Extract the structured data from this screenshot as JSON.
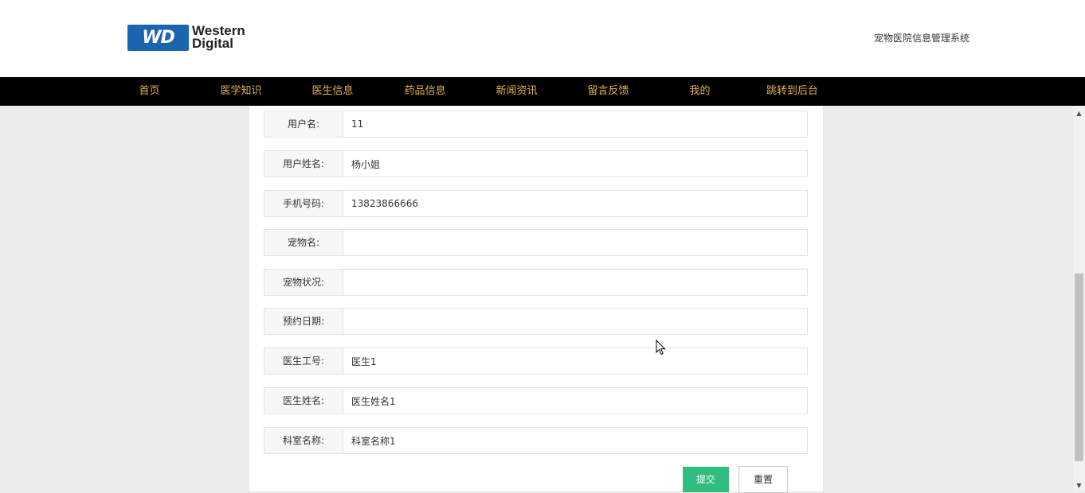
{
  "header": {
    "logo": {
      "badge": "WD",
      "line1": "Western",
      "line2": "Digital"
    },
    "site_title": "宠物医院信息管理系统"
  },
  "nav": {
    "items": [
      {
        "label": "首页"
      },
      {
        "label": "医学知识"
      },
      {
        "label": "医生信息"
      },
      {
        "label": "药品信息"
      },
      {
        "label": "新闻资讯"
      },
      {
        "label": "留言反馈"
      },
      {
        "label": "我的"
      },
      {
        "label": "跳转到后台"
      }
    ]
  },
  "form": {
    "fields": [
      {
        "label": "用户名:",
        "value": "11"
      },
      {
        "label": "用户姓名:",
        "value": "杨小姐"
      },
      {
        "label": "手机号码:",
        "value": "13823866666"
      },
      {
        "label": "宠物名:",
        "value": ""
      },
      {
        "label": "宠物状况:",
        "value": ""
      },
      {
        "label": "预约日期:",
        "value": ""
      },
      {
        "label": "医生工号:",
        "value": "医生1"
      },
      {
        "label": "医生姓名:",
        "value": "医生姓名1"
      },
      {
        "label": "科室名称:",
        "value": "科室名称1"
      }
    ],
    "submit_label": "提交",
    "reset_label": "重置"
  },
  "colors": {
    "nav_bg": "#000000",
    "nav_text": "#e6b24b",
    "submit_bg": "#2fbe7e",
    "logo_blue": "#1a64b0"
  }
}
